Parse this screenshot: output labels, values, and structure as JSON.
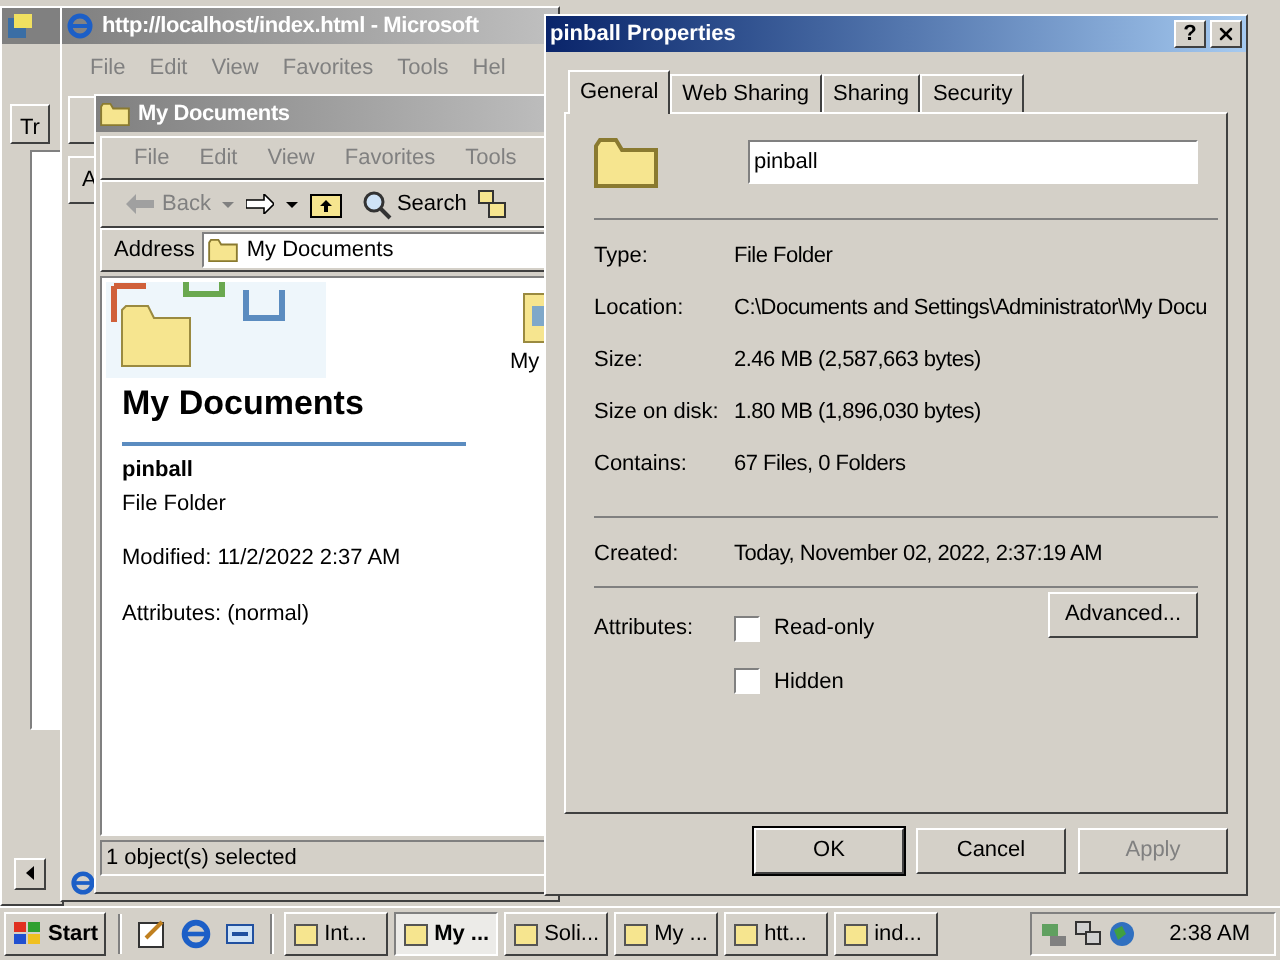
{
  "left_window": {
    "tab": "Tr"
  },
  "browser_window": {
    "title": "http://localhost/index.html - Microsoft",
    "menu": [
      "File",
      "Edit",
      "View",
      "Favorites",
      "Tools",
      "Hel"
    ],
    "address_fragment": "A"
  },
  "explorer_window": {
    "title": "My Documents",
    "menu": [
      "File",
      "Edit",
      "View",
      "Favorites",
      "Tools"
    ],
    "back": "Back",
    "search": "Search",
    "address_label": "Address",
    "address_value": "My Documents",
    "heading": "My Documents",
    "item_name": "pinball",
    "item_type": "File Folder",
    "modified": "Modified: 11/2/2022 2:37 AM",
    "attributes": "Attributes: (normal)",
    "icon_label": "My",
    "status": "1 object(s) selected"
  },
  "dialog": {
    "title": "pinball Properties",
    "help": "?",
    "tabs": [
      {
        "label": "General",
        "selected": true
      },
      {
        "label": "Web Sharing",
        "selected": false
      },
      {
        "label": "Sharing",
        "selected": false
      },
      {
        "label": "Security",
        "selected": false
      }
    ],
    "name_value": "pinball",
    "info_groups": [
      [
        {
          "label": "Type:",
          "value": "File Folder"
        },
        {
          "label": "Location:",
          "value": "C:\\Documents and Settings\\Administrator\\My Docu"
        },
        {
          "label": "Size:",
          "value": "2.46 MB (2,587,663 bytes)"
        },
        {
          "label": "Size on disk:",
          "value": "1.80 MB (1,896,030 bytes)"
        },
        {
          "label": "Contains:",
          "value": "67 Files, 0 Folders"
        }
      ],
      [
        {
          "label": "Created:",
          "value": "Today, November 02, 2022, 2:37:19 AM"
        }
      ]
    ],
    "attributes_label": "Attributes:",
    "checkboxes": [
      {
        "label": "Read-only",
        "checked": false
      },
      {
        "label": "Hidden",
        "checked": false
      }
    ],
    "advanced": "Advanced...",
    "buttons": [
      {
        "label": "OK",
        "default": true,
        "disabled": false
      },
      {
        "label": "Cancel",
        "default": false,
        "disabled": false
      },
      {
        "label": "Apply",
        "default": false,
        "disabled": true
      }
    ]
  },
  "taskbar": {
    "start": "Start",
    "tasks": [
      {
        "label": "Int...",
        "selected": false
      },
      {
        "label": "My ...",
        "selected": true
      },
      {
        "label": "Soli...",
        "selected": false
      },
      {
        "label": "My ...",
        "selected": false
      },
      {
        "label": "htt...",
        "selected": false
      },
      {
        "label": "ind...",
        "selected": false
      }
    ],
    "clock": "2:38 AM"
  }
}
